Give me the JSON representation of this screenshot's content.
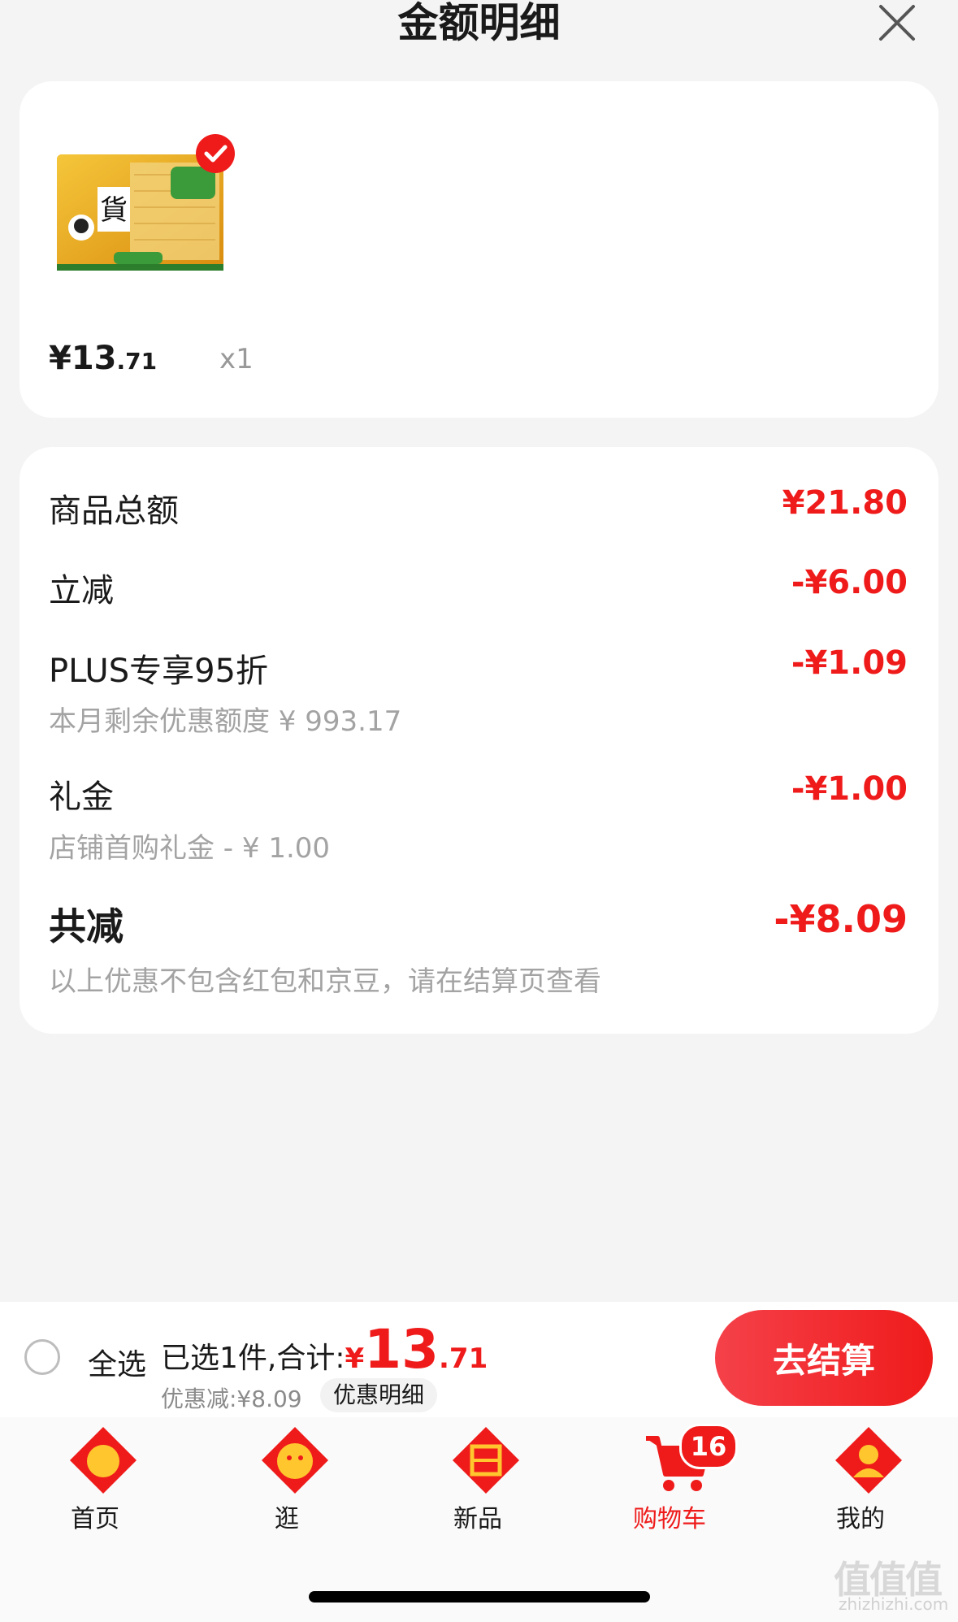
{
  "header": {
    "title": "金额明细",
    "close_icon": "close-icon"
  },
  "product": {
    "image_icon": "product-snack-image",
    "selected": true,
    "price_currency": "¥",
    "price_int": "13",
    "price_dec": ".71",
    "quantity": "x1"
  },
  "breakdown": {
    "total_label": "商品总额",
    "total_amount": "¥21.80",
    "instant_label": "立减",
    "instant_amount": "-¥6.00",
    "plus_label": "PLUS专享95折",
    "plus_sub": "本月剩余优惠额度 ¥ 993.17",
    "plus_amount": "-¥1.09",
    "gift_label": "礼金",
    "gift_sub": "店铺首购礼金 - ¥ 1.00",
    "gift_amount": "-¥1.00",
    "saved_label": "共减",
    "saved_sub": "以上优惠不包含红包和京豆，请在结算页查看",
    "saved_amount": "-¥8.09"
  },
  "checkout_bar": {
    "select_all": "全选",
    "summary_prefix": "已选1件,合计:",
    "total_currency": "¥",
    "total_int": "13",
    "total_dec": ".71",
    "discount": "优惠减:¥8.09",
    "detail_chip": "优惠明细",
    "checkout_label": "去结算"
  },
  "tabs": [
    {
      "label": "首页",
      "icon": "home-icon"
    },
    {
      "label": "逛",
      "icon": "browse-icon"
    },
    {
      "label": "新品",
      "icon": "new-products-icon"
    },
    {
      "label": "购物车",
      "icon": "cart-icon",
      "active": true,
      "badge": "16"
    },
    {
      "label": "我的",
      "icon": "profile-icon"
    }
  ],
  "watermark": {
    "main": "值值值",
    "sub": "zhizhizhi.com"
  },
  "colors": {
    "accent": "#ef1b1b",
    "background": "#f4f4f4"
  }
}
